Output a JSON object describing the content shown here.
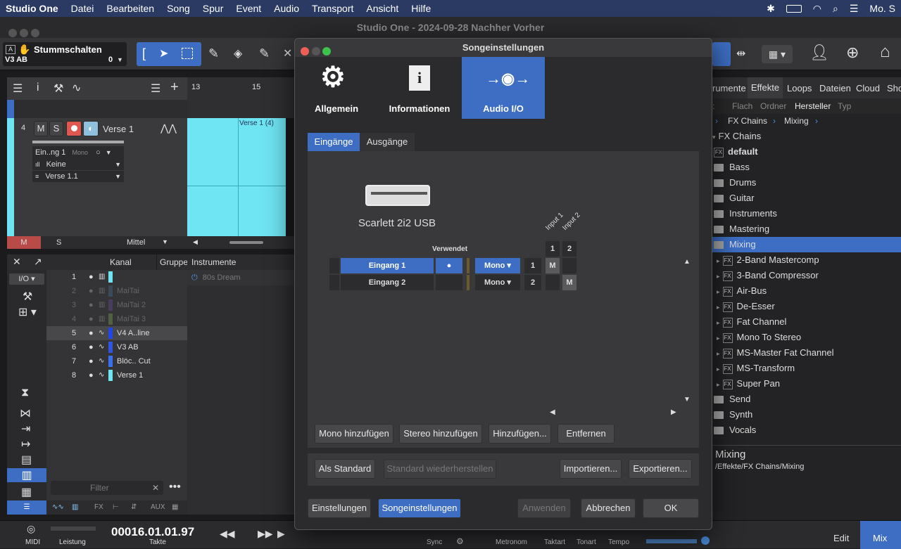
{
  "menubar": {
    "app": "Studio One",
    "items": [
      "Datei",
      "Bearbeiten",
      "Song",
      "Spur",
      "Event",
      "Audio",
      "Transport",
      "Ansicht",
      "Hilfe"
    ],
    "clock": "Mo. S"
  },
  "window_title": "Studio One - 2024-09-28 Nachher Vorher",
  "toolbar": {
    "mute_label": "Stummschalten",
    "track_code": "V3 AB",
    "zero": "0"
  },
  "ruler": {
    "m13": "13",
    "m15": "15"
  },
  "track": {
    "number": "4",
    "m": "M",
    "s": "S",
    "name": "Verse 1",
    "input": "Ein..ng 1",
    "mono": "Mono",
    "output": "Keine",
    "playlist": "Verse 1.1",
    "event_label": "Verse 1 (4)",
    "m_bottom": "M",
    "s_bottom": "S",
    "mittel": "Mittel"
  },
  "inspector": {
    "col_kanal": "Kanal",
    "col_gruppe": "Gruppe",
    "col_instr": "Instrumente",
    "io": "I/O",
    "instr_item": "80s Dream",
    "filter_placeholder": "Filter",
    "fx": "FX",
    "aux": "AUX",
    "tracks": [
      {
        "n": "1",
        "name": "",
        "dim": false,
        "color": "#6fe4f2",
        "sel": false
      },
      {
        "n": "2",
        "name": "MaiTai",
        "dim": true,
        "color": "#3b4a58",
        "sel": false
      },
      {
        "n": "3",
        "name": "MaiTai 2",
        "dim": true,
        "color": "#473d5e",
        "sel": false
      },
      {
        "n": "4",
        "name": "MaiTai 3",
        "dim": true,
        "color": "#506040",
        "sel": false
      },
      {
        "n": "5",
        "name": "V4 A..line",
        "dim": false,
        "color": "#2346e8",
        "sel": true
      },
      {
        "n": "6",
        "name": "V3 AB",
        "dim": false,
        "color": "#2f55e0",
        "sel": false
      },
      {
        "n": "7",
        "name": "Blöc.. Cut",
        "dim": false,
        "color": "#3a6ff0",
        "sel": false
      },
      {
        "n": "8",
        "name": "Verse 1",
        "dim": false,
        "color": "#6fe4f2",
        "sel": false
      }
    ]
  },
  "browser": {
    "tabs": [
      "rumente",
      "Effekte",
      "Loops",
      "Dateien",
      "Cloud",
      "Sho"
    ],
    "sort": [
      "Flach",
      "Ordner",
      "Hersteller",
      "Typ"
    ],
    "path": [
      "FX Chains",
      "Mixing"
    ],
    "items": [
      {
        "label": "FX Chains",
        "kind": "root"
      },
      {
        "label": "default",
        "kind": "fx",
        "bold": true
      },
      {
        "label": "Bass",
        "kind": "folder"
      },
      {
        "label": "Drums",
        "kind": "folder"
      },
      {
        "label": "Guitar",
        "kind": "folder"
      },
      {
        "label": "Instruments",
        "kind": "folder"
      },
      {
        "label": "Mastering",
        "kind": "folder"
      },
      {
        "label": "Mixing",
        "kind": "folder",
        "sel": true
      },
      {
        "label": "2-Band Mastercomp",
        "kind": "fxchild"
      },
      {
        "label": "3-Band Compressor",
        "kind": "fxchild"
      },
      {
        "label": "Air-Bus",
        "kind": "fxchild"
      },
      {
        "label": "De-Esser",
        "kind": "fxchild"
      },
      {
        "label": "Fat Channel",
        "kind": "fxchild"
      },
      {
        "label": "Mono To Stereo",
        "kind": "fxchild"
      },
      {
        "label": "MS-Master Fat Channel",
        "kind": "fxchild"
      },
      {
        "label": "MS-Transform",
        "kind": "fxchild"
      },
      {
        "label": "Super Pan",
        "kind": "fxchild"
      },
      {
        "label": "Send",
        "kind": "folder"
      },
      {
        "label": "Synth",
        "kind": "folder"
      },
      {
        "label": "Vocals",
        "kind": "folder"
      }
    ],
    "footer_title": "Mixing",
    "footer_path": "/Effekte/FX Chains/Mixing"
  },
  "transport": {
    "midi": "MIDI",
    "leistung": "Leistung",
    "time": "00016.01.01.97",
    "takte": "Takte",
    "sync": "Sync",
    "metronom": "Metronom",
    "taktart": "Taktart",
    "tonart": "Tonart",
    "tempo": "Tempo",
    "edit": "Edit",
    "mix": "Mix"
  },
  "dialog": {
    "title": "Songeinstellungen",
    "tabs": [
      "Allgemein",
      "Informationen",
      "Audio I/O"
    ],
    "subtabs": [
      "Eingänge",
      "Ausgänge"
    ],
    "device": "Scarlett 2i2 USB",
    "verwendet": "Verwendet",
    "input_headers": [
      "Input 1",
      "Input 2"
    ],
    "col_nums": [
      "1",
      "2"
    ],
    "rows": [
      {
        "name": "Eingang 1",
        "mode": "Mono",
        "num": "1"
      },
      {
        "name": "Eingang 2",
        "mode": "Mono",
        "num": "2"
      }
    ],
    "matrix_m": "M",
    "buttons1": [
      "Mono hinzufügen",
      "Stereo hinzufügen",
      "Hinzufügen...",
      "Entfernen"
    ],
    "buttons2": [
      "Als Standard",
      "Standard wiederherstellen",
      "Importieren...",
      "Exportieren..."
    ],
    "footer": {
      "einstellungen": "Einstellungen",
      "songeinstellungen": "Songeinstellungen",
      "anwenden": "Anwenden",
      "abbrechen": "Abbrechen",
      "ok": "OK"
    }
  },
  "colors": {
    "accent": "#3d6ec4",
    "clip": "#6fe4f2",
    "menubar": "#2b3a63"
  }
}
